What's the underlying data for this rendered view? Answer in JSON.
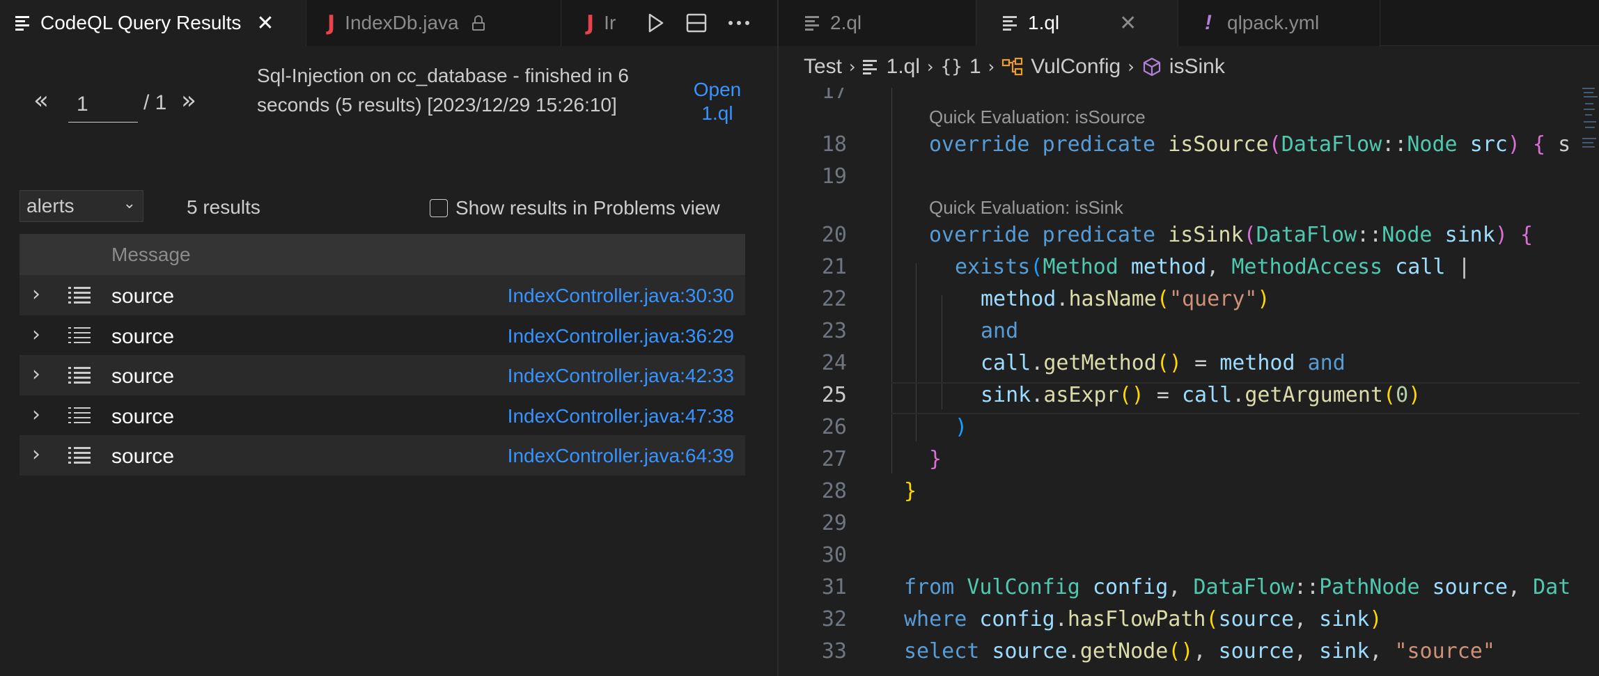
{
  "left_tabs": [
    {
      "label": "CodeQL Query Results",
      "icon": "lines-icon",
      "active": true
    },
    {
      "label": "IndexDb.java",
      "icon": "java-icon",
      "active": false
    },
    {
      "label": "Ir",
      "icon": "java-icon",
      "active": false
    }
  ],
  "right_tabs": [
    {
      "label": "2.ql",
      "icon": "lines-icon",
      "active": false
    },
    {
      "label": "1.ql",
      "icon": "lines-icon",
      "active": true
    },
    {
      "label": "qlpack.yml",
      "icon": "exclamation-icon",
      "active": false
    }
  ],
  "results": {
    "page_current": "1",
    "page_total": "/ 1",
    "query_info": "Sql-Injection on cc_database - finished in 6 seconds (5 results) [2023/12/29 15:26:10]",
    "open_link": "Open 1.ql",
    "view_select": "alerts",
    "count": "5 results",
    "problems_label": "Show results in Problems view",
    "column_message": "Message",
    "rows": [
      {
        "message": "source",
        "location": "IndexController.java:30:30"
      },
      {
        "message": "source",
        "location": "IndexController.java:36:29"
      },
      {
        "message": "source",
        "location": "IndexController.java:42:33"
      },
      {
        "message": "source",
        "location": "IndexController.java:47:38"
      },
      {
        "message": "source",
        "location": "IndexController.java:64:39"
      }
    ]
  },
  "breadcrumb": {
    "items": [
      "Test",
      "1.ql",
      "1",
      "VulConfig",
      "isSink"
    ]
  },
  "editor": {
    "line_numbers": [
      "17",
      "18",
      "19",
      "20",
      "21",
      "22",
      "23",
      "24",
      "25",
      "26",
      "27",
      "28",
      "29",
      "30",
      "31",
      "32",
      "33"
    ],
    "codelens": [
      "Quick Evaluation: isSource",
      "Quick Evaluation: isSink"
    ],
    "current_line": "25"
  },
  "colors": {
    "link": "#3794ff",
    "keyword": "#569cd6",
    "function": "#dcdcaa",
    "type": "#4ec9b0",
    "string": "#ce9178",
    "java_icon": "#e8424a"
  }
}
